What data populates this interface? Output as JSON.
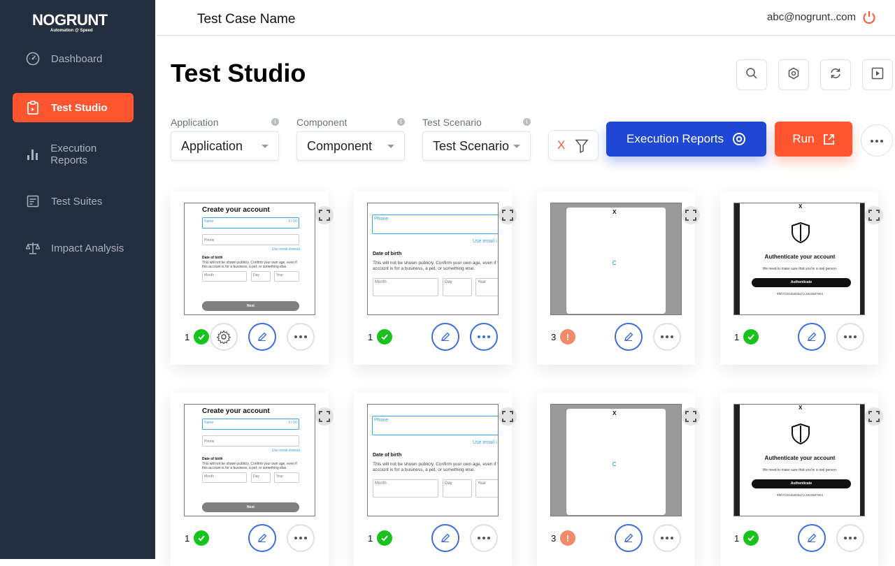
{
  "brand": {
    "name": "NOGRUNT",
    "tagline": "Automation @ Speed"
  },
  "sidebar": {
    "items": [
      {
        "label": "Dashboard",
        "icon": "gauge-icon"
      },
      {
        "label": "Test Studio",
        "icon": "clipboard-icon",
        "active": true
      },
      {
        "label": "Execution Reports",
        "icon": "bar-chart-icon"
      },
      {
        "label": "Test Suites",
        "icon": "checklist-icon"
      },
      {
        "label": "Impact Analysis",
        "icon": "scale-icon"
      }
    ]
  },
  "header": {
    "test_case_name": "Test Case Name",
    "user_email": "abc@nogrunt..com"
  },
  "page": {
    "title": "Test Studio"
  },
  "filters": {
    "application": {
      "label": "Application",
      "value": "Application"
    },
    "component": {
      "label": "Component",
      "value": "Component"
    },
    "scenario": {
      "label": "Test Scenario",
      "value": "Test Scenario"
    },
    "clear_label": "X"
  },
  "actions": {
    "execution_reports": "Execution Reports",
    "run": "Run"
  },
  "colors": {
    "sidebar_bg": "#232f3e",
    "accent": "#ff5630",
    "primary": "#1f47d3",
    "success": "#18c21f",
    "warning": "#f28a68"
  },
  "screens": {
    "signup": {
      "title": "Create your account",
      "name_label": "Name",
      "name_counter": "0 / 50",
      "phone_label": "Phone",
      "email_link": "Use email instead",
      "dob_title": "Date of birth",
      "dob_text": "This will not be shown publicly. Confirm your own age, even if this account is for a business, a pet, or something else.",
      "month": "Month",
      "day": "Day",
      "year": "Year",
      "next": "Next"
    },
    "phone": {
      "phone_label": "Phone",
      "email_link": "Use email i",
      "dob_title": "Date of birth",
      "dob_text": "This will not be shown publicly. Confirm your own age, even if t account is for a business, a pet, or something else.",
      "month": "Month",
      "day": "Day",
      "year": "Year"
    },
    "loading": {
      "close": "X"
    },
    "auth": {
      "close": "X",
      "title": "Authenticate your account",
      "text": "We need to make sure that you're a real person.",
      "button": "Authenticate",
      "code": "9f0f7c022da026a72.2922687904"
    }
  },
  "cards": [
    {
      "count": "1",
      "status": "ok",
      "screen": "signup"
    },
    {
      "count": "1",
      "status": "ok",
      "screen": "phone"
    },
    {
      "count": "3",
      "status": "err",
      "status_symbol": "!",
      "screen": "loading"
    },
    {
      "count": "1",
      "status": "ok",
      "screen": "auth"
    },
    {
      "count": "1",
      "status": "ok",
      "screen": "signup"
    },
    {
      "count": "1",
      "status": "ok",
      "screen": "phone"
    },
    {
      "count": "3",
      "status": "err",
      "status_symbol": "!",
      "screen": "loading"
    },
    {
      "count": "1",
      "status": "ok",
      "screen": "auth"
    }
  ]
}
